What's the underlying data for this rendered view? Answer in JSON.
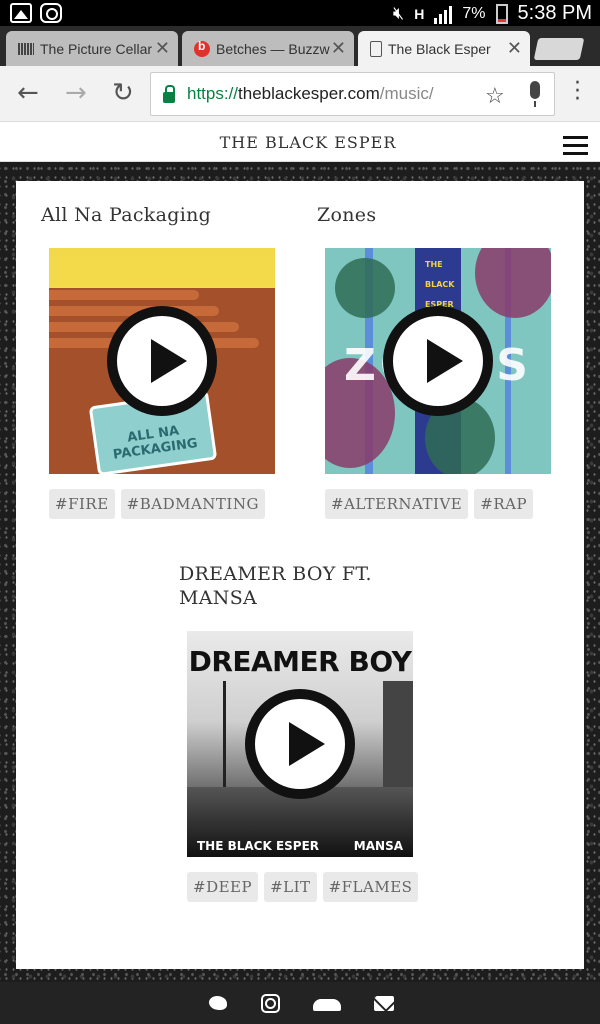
{
  "status_bar": {
    "time": "5:38 PM",
    "battery_percent": "7%",
    "network": "H",
    "icons": [
      "gallery-icon",
      "instagram-icon",
      "mute-icon",
      "signal-icon",
      "battery-icon"
    ]
  },
  "browser": {
    "tabs": [
      {
        "label": "The Picture Cellar",
        "icon": "barcode-icon",
        "active": false
      },
      {
        "label": "Betches — Buzzw",
        "icon": "buzzfeed-icon",
        "active": false
      },
      {
        "label": "The Black Esper",
        "icon": "document-icon",
        "active": true
      }
    ],
    "url": {
      "scheme": "https://",
      "host": "theblackesper.com",
      "path": "/music/"
    }
  },
  "site": {
    "title": "THE BLACK ESPER"
  },
  "albums": [
    {
      "title": "All Na Packaging",
      "cover_text": "ALL NA PACKAGING",
      "tags": [
        "#FIRE",
        "#BADMANTING"
      ]
    },
    {
      "title": "Zones",
      "cover_text": "ZONES",
      "cover_small": [
        "THE",
        "BLACK",
        "ESPER"
      ],
      "tags": [
        "#ALTERNATIVE",
        "#RAP"
      ]
    },
    {
      "title": "DREAMER BOY FT.",
      "title_line2": "MANSA",
      "cover_text": "DREAMER BOY",
      "cover_bottom_left": "THE BLACK ESPER",
      "cover_bottom_right": "MANSA",
      "tags": [
        "#DEEP",
        "#LIT",
        "#FLAMES"
      ]
    }
  ],
  "footer": {
    "icons": [
      "twitter-icon",
      "instagram-icon",
      "soundcloud-icon",
      "mail-icon"
    ]
  },
  "colors": {
    "url_green": "#0b8043",
    "tag_bg": "#e9e9e9",
    "footer_bg": "#232323"
  }
}
